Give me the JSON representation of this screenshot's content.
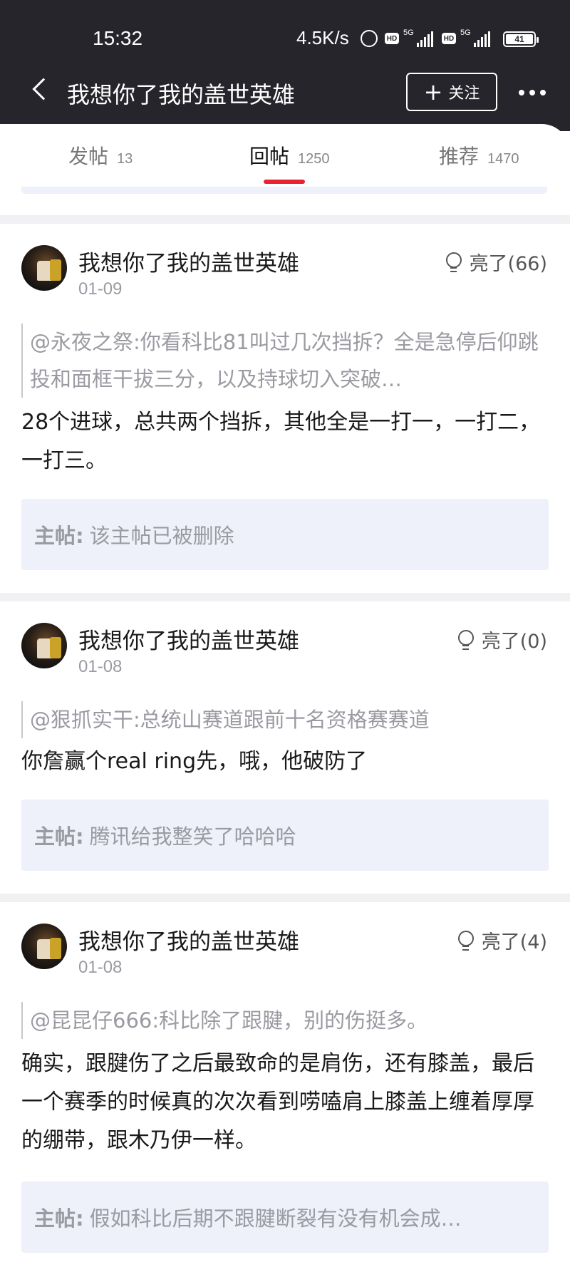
{
  "status_bar": {
    "time": "15:32",
    "speed": "4.5K/s",
    "hd1": "HD",
    "net1": "5G",
    "hd2": "HD",
    "net2": "5G",
    "battery": "41"
  },
  "header": {
    "title": "我想你了我的盖世英雄",
    "follow_label": "关注",
    "back_icon": "chevron-left-icon",
    "more_icon": "more-dots-icon"
  },
  "tabs": [
    {
      "label": "发帖",
      "count": "13",
      "active": false
    },
    {
      "label": "回帖",
      "count": "1250",
      "active": true
    },
    {
      "label": "推荐",
      "count": "1470",
      "active": false
    }
  ],
  "colors": {
    "header_bg": "#25252b",
    "tab_indicator": "#e8222e",
    "main_box_bg": "#eef0fa"
  },
  "posts": [
    {
      "user": "我想你了我的盖世英雄",
      "date": "01-09",
      "light": "亮了(66)",
      "quote": "@永夜之祭:你看科比81叫过几次挡拆？全是急停后仰跳投和面框干拔三分，以及持球切入突破…",
      "content": "28个进球，总共两个挡拆，其他全是一打一，一打二，一打三。",
      "main_label": "主帖:",
      "main_text": "该主帖已被删除"
    },
    {
      "user": "我想你了我的盖世英雄",
      "date": "01-08",
      "light": "亮了(0)",
      "quote": "@狠抓实干:总统山赛道跟前十名资格赛赛道",
      "content": "你詹赢个real ring先，哦，他破防了",
      "main_label": "主帖:",
      "main_text": "腾讯给我整笑了哈哈哈"
    },
    {
      "user": "我想你了我的盖世英雄",
      "date": "01-08",
      "light": "亮了(4)",
      "quote": "@昆昆仔666:科比除了跟腱，别的伤挺多。",
      "content": "确实，跟腱伤了之后最致命的是肩伤，还有膝盖，最后一个赛季的时候真的次次看到唠嗑肩上膝盖上缠着厚厚的绷带，跟木乃伊一样。",
      "main_label": "主帖:",
      "main_text": "假如科比后期不跟腱断裂有没有机会成…"
    }
  ]
}
